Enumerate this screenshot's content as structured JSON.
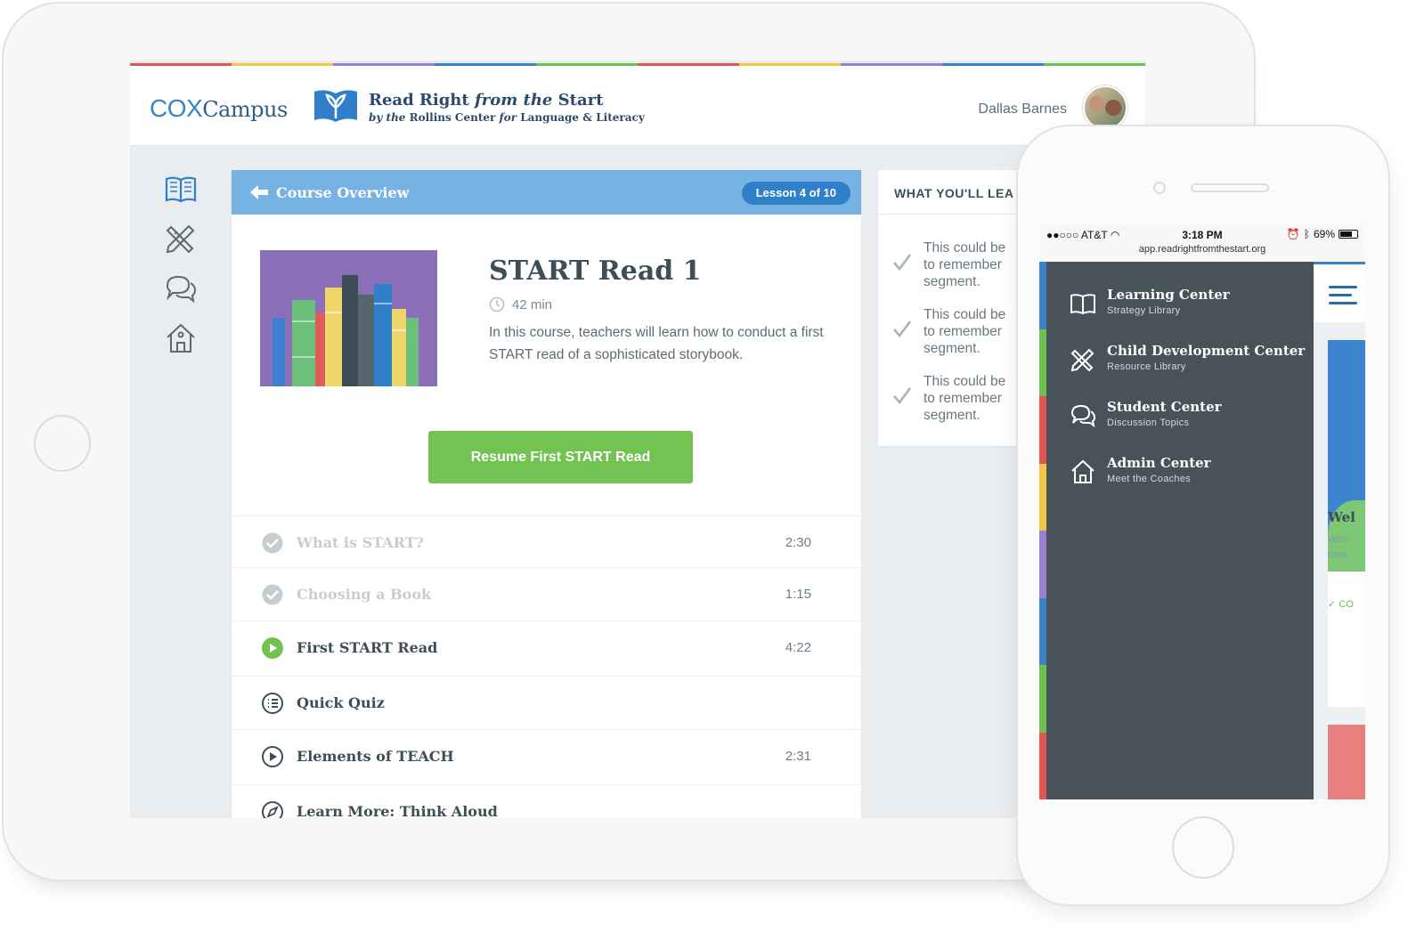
{
  "colors": {
    "stripe": [
      "#e25454",
      "#f4c542",
      "#9b7fd1",
      "#3a83c8",
      "#6cc14f",
      "#e25454",
      "#f4c542",
      "#9b7fd1",
      "#3a83c8",
      "#6cc14f"
    ],
    "accent_blue": "#77b2e4",
    "pill_blue": "#2f7fc9",
    "resume_green": "#73c353",
    "menu_bg": "#485359"
  },
  "header": {
    "logo_cox": "COX",
    "logo_campus": "Campus",
    "brand_title_a": "Read Right ",
    "brand_title_b": "from the",
    "brand_title_c": " Start",
    "brand_sub_a": "by the ",
    "brand_sub_b": "Rollins Center",
    "brand_sub_c": " for ",
    "brand_sub_d": "Language & Literacy",
    "user_name": "Dallas Barnes"
  },
  "leftnav": {
    "icons": [
      "book-icon",
      "pencil-ruler-icon",
      "chat-bubbles-icon",
      "house-icon"
    ]
  },
  "course": {
    "back_label": "Course Overview",
    "lesson_pill": "Lesson 4 of 10",
    "title": "START Read 1",
    "duration": "42 min",
    "description": "In this course, teachers will learn how to conduct a first START read of a sophisticated storybook.",
    "resume_button": "Resume First START Read",
    "lessons": [
      {
        "label": "What is START?",
        "time": "2:30",
        "state": "done",
        "icon": "check-circle-icon"
      },
      {
        "label": "Choosing a Book",
        "time": "1:15",
        "state": "done",
        "icon": "check-circle-icon"
      },
      {
        "label": "First START Read",
        "time": "4:22",
        "state": "current",
        "icon": "play-circle-filled-icon"
      },
      {
        "label": "Quick Quiz",
        "time": "",
        "state": "todo",
        "icon": "quiz-list-icon"
      },
      {
        "label": "Elements of TEACH",
        "time": "2:31",
        "state": "todo",
        "icon": "play-circle-icon"
      },
      {
        "label": "Learn More: Think Aloud",
        "time": "",
        "state": "todo",
        "icon": "compass-icon"
      }
    ]
  },
  "learn": {
    "heading": "WHAT YOU'LL LEA",
    "items": [
      "This could be\nto remember\nsegment.",
      "This could be\nto remember\nsegment.",
      "This could be\nto remember\nsegment."
    ]
  },
  "phone": {
    "carrier": "●●○○○ AT&T",
    "time": "3:18 PM",
    "battery": "69%",
    "url": "app.readrightfromthestart.org",
    "menu": [
      {
        "title": "Learning Center",
        "sub": "Strategy Library",
        "icon": "book-icon"
      },
      {
        "title": "Child Development Center",
        "sub": "Resource Library",
        "icon": "pencil-ruler-icon"
      },
      {
        "title": "Student Center",
        "sub": "Discussion Topics",
        "icon": "chat-bubbles-icon"
      },
      {
        "title": "Admin Center",
        "sub": "Meet the Coaches",
        "icon": "house-icon"
      }
    ],
    "bg_card_title": "Wel",
    "bg_card_text": "Welc\ncoac",
    "bg_card_link": "✓ CO"
  }
}
